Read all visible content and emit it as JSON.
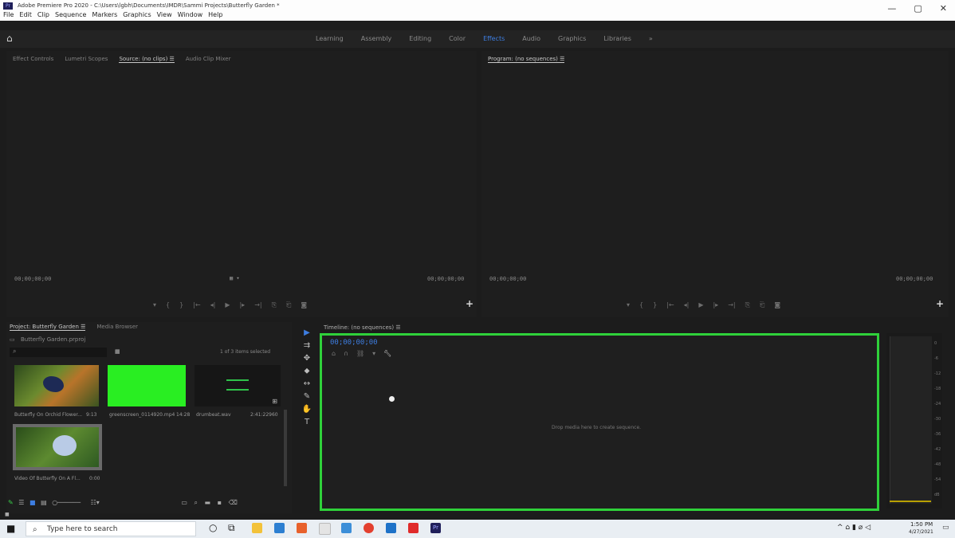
{
  "window": {
    "title": "Adobe Premiere Pro 2020 - C:\\Users\\lgbh\\Documents\\IMDR\\Sammi Projects\\Butterfly Garden *",
    "app_icon_label": "Pr",
    "menu": [
      "File",
      "Edit",
      "Clip",
      "Sequence",
      "Markers",
      "Graphics",
      "View",
      "Window",
      "Help"
    ],
    "controls": [
      "—",
      "▢",
      "✕"
    ]
  },
  "workspaces": {
    "tabs": [
      "Learning",
      "Assembly",
      "Editing",
      "Color",
      "Effects",
      "Audio",
      "Graphics",
      "Libraries"
    ],
    "active": "Effects",
    "overflow": "»"
  },
  "source_panel": {
    "tabs": [
      "Effect Controls",
      "Lumetri Scopes",
      "Source: (no clips) ☰",
      "Audio Clip Mixer"
    ],
    "selected_tab": "Source: (no clips) ☰",
    "timecode_left": "00;00;00;00",
    "timecode_right": "00;00;00;00",
    "fit_label": "▦ ▾"
  },
  "program_panel": {
    "tab": "Program: (no sequences) ☰",
    "timecode_left": "00;00;00;00",
    "timecode_right": "00;00;00;00"
  },
  "transport_controls": [
    "▾",
    "{",
    "}",
    "|←",
    "◂|",
    "▶",
    "|▸",
    "→|",
    "⎘",
    "⎗",
    "◙"
  ],
  "project_panel": {
    "tabs": [
      "Project: Butterfly Garden ☰",
      "Media Browser"
    ],
    "bin_name": "Butterfly Garden.prproj",
    "search_placeholder": "",
    "item_count": "1 of 3 items selected",
    "items": [
      {
        "name": "Butterfly On Orchid Flower...",
        "duration": "9:13"
      },
      {
        "name": "greenscreen_0114920.mp4",
        "duration": "14:28"
      },
      {
        "name": "drumbeat.wav",
        "duration": "2:41:22960"
      },
      {
        "name": "Video Of Butterfly On A Fl...",
        "duration": "0:00"
      }
    ],
    "bottom_icons": [
      "pencil-icon",
      "list-view-icon",
      "icon-view-icon",
      "freeform-view-icon",
      "zoom-slider",
      "sort-icon",
      "automate-icon",
      "find-icon",
      "new-bin-icon",
      "new-item-icon",
      "clear-icon"
    ]
  },
  "tools": [
    "▶",
    "⇉",
    "✥",
    "⬥",
    "↔",
    "✎",
    "✋",
    "T"
  ],
  "timeline": {
    "tab": "Timeline: (no sequences) ☰",
    "timecode": "00;00;00;00",
    "hint": "Drop media here to create sequence."
  },
  "meters": {
    "scale": [
      "0",
      "-6",
      "-12",
      "-18",
      "-24",
      "-30",
      "-36",
      "-42",
      "-48",
      "-54",
      "dB"
    ],
    "footer": "S S"
  },
  "taskbar": {
    "search_placeholder": "Type here to search",
    "time": "1:50 PM",
    "date": "4/27/2021"
  },
  "colors": {
    "highlight_border": "#2fd13a",
    "active_tab": "#3d7de0",
    "green_thumb": "#29ee22"
  }
}
